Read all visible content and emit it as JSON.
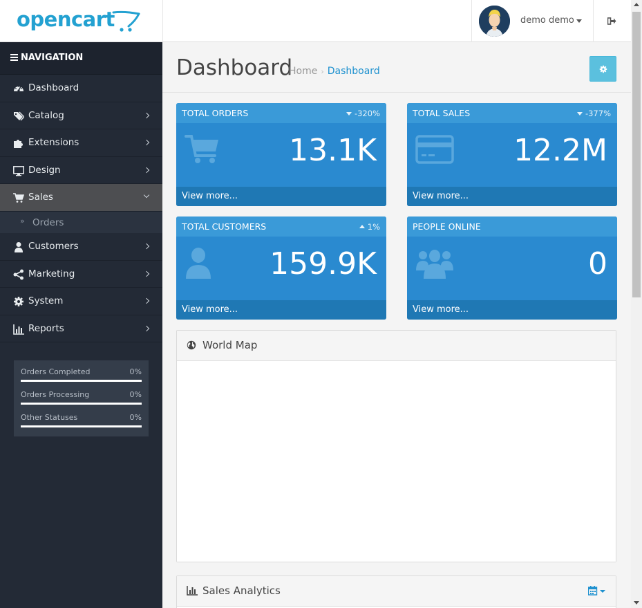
{
  "header": {
    "logo_text": "opencart",
    "user_name": "demo demo"
  },
  "nav": {
    "title": "NAVIGATION",
    "items": [
      {
        "label": "Dashboard",
        "icon": "dashboard-icon"
      },
      {
        "label": "Catalog",
        "icon": "tags-icon"
      },
      {
        "label": "Extensions",
        "icon": "puzzle-icon"
      },
      {
        "label": "Design",
        "icon": "monitor-icon"
      },
      {
        "label": "Sales",
        "icon": "cart-icon"
      },
      {
        "label": "Customers",
        "icon": "user-icon"
      },
      {
        "label": "Marketing",
        "icon": "share-icon"
      },
      {
        "label": "System",
        "icon": "gear-icon"
      },
      {
        "label": "Reports",
        "icon": "bar-chart-icon"
      }
    ],
    "sales_sub": {
      "label": "Orders"
    },
    "stats": [
      {
        "name": "Orders Completed",
        "value": "0%"
      },
      {
        "name": "Orders Processing",
        "value": "0%"
      },
      {
        "name": "Other Statuses",
        "value": "0%"
      }
    ]
  },
  "page": {
    "title": "Dashboard",
    "breadcrumb_home": "Home",
    "breadcrumb_current": "Dashboard"
  },
  "tiles": [
    {
      "title": "TOTAL ORDERS",
      "change": "-320%",
      "direction": "down",
      "value": "13.1K",
      "footer": "View more...",
      "icon": "cart-icon"
    },
    {
      "title": "TOTAL SALES",
      "change": "-377%",
      "direction": "down",
      "value": "12.2M",
      "footer": "View more...",
      "icon": "credit-card-icon"
    },
    {
      "title": "TOTAL CUSTOMERS",
      "change": "1%",
      "direction": "up",
      "value": "159.9K",
      "footer": "View more...",
      "icon": "user-icon"
    },
    {
      "title": "PEOPLE ONLINE",
      "change": "",
      "direction": "",
      "value": "0",
      "footer": "View more...",
      "icon": "users-icon"
    }
  ],
  "panels": {
    "world_map": "World Map",
    "sales_analytics": "Sales Analytics"
  },
  "colors": {
    "brand": "#23a1d1",
    "tile_blue": "#2a8ad0",
    "sidebar": "#232a36",
    "link": "#1e91cf",
    "settings_button": "#5bc0de"
  }
}
